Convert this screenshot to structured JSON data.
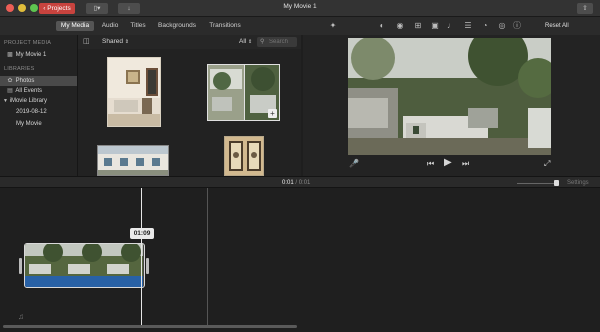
{
  "window": {
    "title": "My Movie 1",
    "projects_label": "Projects"
  },
  "tabs": [
    {
      "label": "My Media",
      "active": true
    },
    {
      "label": "Audio",
      "active": false
    },
    {
      "label": "Titles",
      "active": false
    },
    {
      "label": "Backgrounds",
      "active": false
    },
    {
      "label": "Transitions",
      "active": false
    }
  ],
  "toolbar": {
    "reset_all": "Reset All",
    "icons": [
      "magic-wand-icon",
      "color-balance-icon",
      "color-correction-icon",
      "crop-icon",
      "stabilization-icon",
      "volume-icon",
      "noise-reduction-icon",
      "speed-icon",
      "filter-icon",
      "info-icon"
    ]
  },
  "sidebar": {
    "project_media_header": "PROJECT MEDIA",
    "project_item": "My Movie 1",
    "libraries_header": "LIBRARIES",
    "items": [
      {
        "label": "Photos",
        "selected": true
      },
      {
        "label": "All Events",
        "selected": false
      },
      {
        "label": "iMovie Library",
        "selected": false
      },
      {
        "label": "2019-08-12",
        "selected": false
      },
      {
        "label": "My Movie",
        "selected": false
      }
    ]
  },
  "browser": {
    "source": "Shared",
    "filter": "All",
    "search_placeholder": "Search"
  },
  "timeline": {
    "current_time": "0:01",
    "separator": "/",
    "total_time": "0:01",
    "settings_label": "Settings",
    "playhead_tooltip": "01:09"
  },
  "colors": {
    "accent_red": "#c8433e",
    "audio_blue": "#2861a6",
    "selection": "#4a4a4a"
  }
}
